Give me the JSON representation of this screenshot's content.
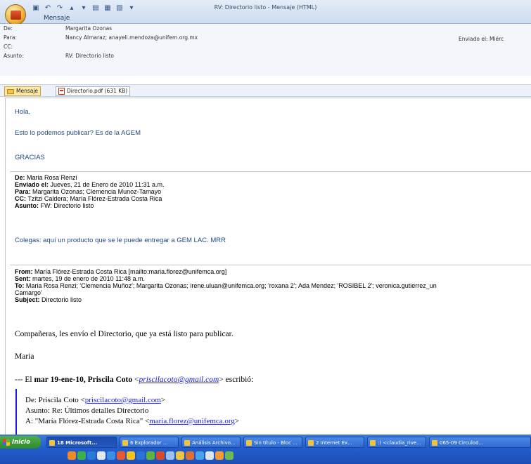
{
  "window": {
    "title": "RV: Directorio listo - Mensaje (HTML)",
    "ribbon_tab": "Mensaje",
    "qat_icons": [
      "save-icon",
      "undo-icon",
      "redo-icon",
      "up-icon",
      "down-icon",
      "print-icon",
      "attach-icon",
      "forward-icon",
      "dropdown-icon"
    ]
  },
  "header": {
    "from_label": "De:",
    "from_value": "Margarita Ozonas",
    "to_label": "Para:",
    "to_value": "Nancy Almaraz; anayeli.mendoza@unifem.org.mx",
    "cc_label": "CC:",
    "cc_value": "",
    "subject_label": "Asunto:",
    "subject_value": "RV: Directorio listo",
    "sent_label": "Enviado el:",
    "sent_value": "Miérc"
  },
  "attachments": {
    "message_label": "Mensaje",
    "file_label": "Directorio.pdf (631 KB)"
  },
  "body": {
    "greeting": "Hola,",
    "line1": "Esto lo podemos publicar? Es de la AGEM",
    "thanks": "GRACIAS",
    "fwd1": {
      "from_label": "De:",
      "from_value": "Maria Rosa Renzi",
      "sent_label": "Enviado el:",
      "sent_value": "Jueves, 21 de Enero de 2010 11:31 a.m.",
      "to_label": "Para:",
      "to_value": "Margarita Ozonas; Clemencia Munoz-Tamayo",
      "cc_label": "CC:",
      "cc_value": "Tzitzi Caldera; María Flórez-Estrada Costa Rica",
      "subject_label": "Asunto:",
      "subject_value": "FW: Directorio listo"
    },
    "colegas": "Colegas: aquí un producto que se le puede entregar a GEM LAC. MRR",
    "fwd2": {
      "from_label": "From:",
      "from_value": "María Flórez-Estrada Costa Rica [mailto:maria.florez@unifemca.org]",
      "sent_label": "Sent:",
      "sent_value": "martes, 19 de enero de 2010 11:48 a.m.",
      "to_label": "To:",
      "to_value": "Maria Rosa Renzi; 'Clemencia Muñoz'; Margarita Ozonas; irene.uluan@unifemca.org; 'roxana 2'; Ada Mendez; 'ROSIBEL 2'; veronica.gutierrez_un",
      "to_value2": "Camargo'",
      "subject_label": "Subject:",
      "subject_value": "Directorio listo"
    },
    "companeras": "Compañeras, les envío el Directorio, que ya está listo para publicar.",
    "signature": "Maria",
    "quote_intro_pre": "--- El",
    "quote_intro_bold": "mar 19-ene-10, Priscila Coto",
    "quote_intro_email": "priscilacoto@gmail.com",
    "quote_intro_post": "escribió:",
    "quoted": {
      "from_pre": "De: Priscila Coto <",
      "from_email": "priscilacoto@gmail.com",
      "from_post": ">",
      "subject": "Asunto: Re: Últimos detalles Directorio",
      "to_pre": "A: \"María Flórez-Estrada Costa Rica\" <",
      "to_email": "maria.florez@unifemca.org",
      "to_post": ">"
    }
  },
  "taskbar": {
    "start_label": "Inicio",
    "buttons": [
      "18 Microsoft...",
      "6 Explorador ...",
      "Análisis Archivo...",
      "Sin título - Bloc ...",
      "2 Internet Ex...",
      ":) <claudia_rive...",
      "065-09 Circulod..."
    ]
  }
}
